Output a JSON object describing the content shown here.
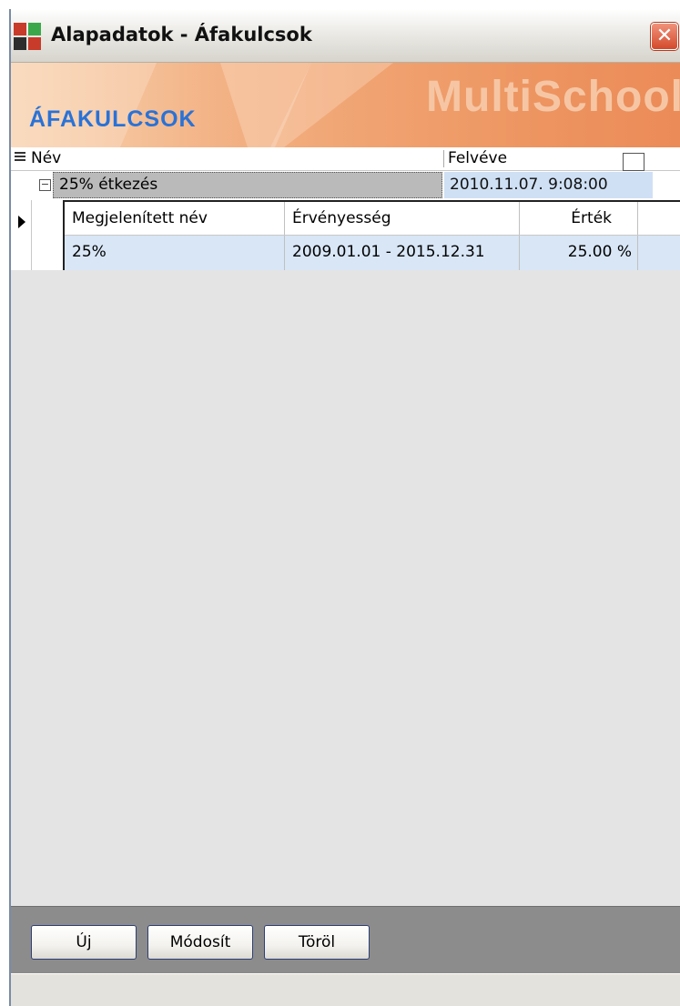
{
  "window": {
    "title": "Alapadatok - Áfakulcsok",
    "close_symbol": "✕"
  },
  "banner": {
    "title": "ÁFAKULCSOK",
    "brand": "MultiSchool"
  },
  "grid": {
    "columns": [
      {
        "label": "Név"
      },
      {
        "label": "Felvéve"
      }
    ],
    "group_row": {
      "name": "25% étkezés",
      "date": "2010.11.07. 9:08:00",
      "expanded": true
    },
    "detail": {
      "columns": [
        {
          "label": "Megjelenített név"
        },
        {
          "label": "Érvényesség"
        },
        {
          "label": "Érték"
        }
      ],
      "rows": [
        {
          "name": "25%",
          "validity": "2009.01.01 - 2015.12.31",
          "value": "25.00 %"
        }
      ]
    }
  },
  "buttons": {
    "new_label": "Új",
    "edit_label": "Módosít",
    "delete_label": "Töröl"
  },
  "colors": {
    "banner_title": "#2a72d6",
    "selected_row": "#d8e6f6",
    "button_border": "#2d3f75"
  },
  "icons": [
    "app-icon",
    "close-icon",
    "column-chooser-icon",
    "collapse-icon",
    "row-indicator-icon",
    "checkbox-icon"
  ]
}
